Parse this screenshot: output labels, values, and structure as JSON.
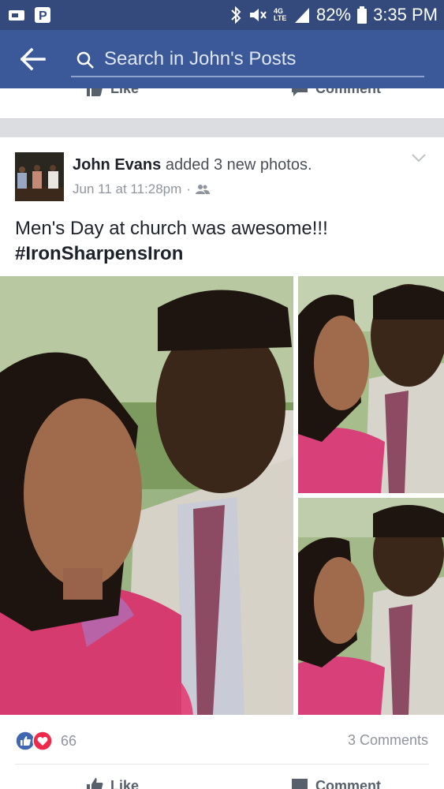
{
  "status_bar": {
    "network": "4G LTE",
    "battery": "82%",
    "time": "3:35 PM",
    "icons": [
      "video-icon",
      "parking-icon",
      "bluetooth-icon",
      "mute-icon",
      "signal-icon",
      "battery-icon"
    ]
  },
  "header": {
    "search_text": "Search in John's Posts",
    "back_icon": "back-arrow-icon",
    "search_icon": "search-icon"
  },
  "previous_post": {
    "like_label": "Like",
    "comment_label": "Comment"
  },
  "post": {
    "author": "John Evans",
    "action_text": "added 3 new photos.",
    "date": "Jun 11 at 11:28pm",
    "separator": "·",
    "audience_icon": "friends-icon",
    "text_line1": "Men's Day at church was awesome!!!",
    "hashtag": "#IronSharpensIron",
    "photo_count": 3,
    "reaction_count": "66",
    "reaction_icons": [
      "like-reaction-icon",
      "love-reaction-icon"
    ],
    "comments": "3 Comments",
    "like_label": "Like",
    "comment_label": "Comment"
  },
  "colors": {
    "status_bar": "#344a7d",
    "header": "#3b5998",
    "like_blue": "#4267b2",
    "love_red": "#f0284a"
  }
}
